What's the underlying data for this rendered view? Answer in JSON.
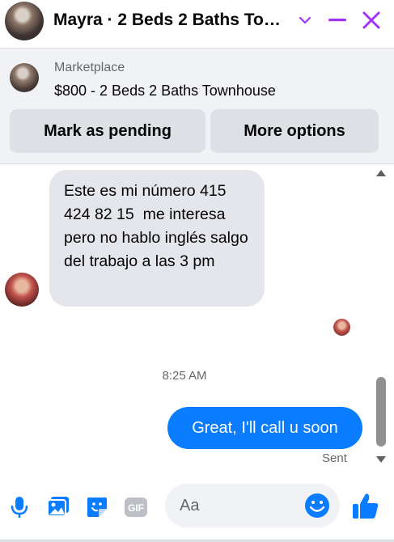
{
  "header": {
    "title": "Mayra · 2 Beds 2 Baths Townhouse",
    "icons": [
      "chevron-down-icon",
      "minimize-icon",
      "close-icon"
    ],
    "accent_color": "#a033ff"
  },
  "marketplace": {
    "label": "Marketplace",
    "listing": "$800 - 2 Beds 2 Baths Townhouse",
    "mark_pending_label": "Mark as pending",
    "more_options_label": "More options"
  },
  "thread": {
    "incoming_message": "Este es mi número 415 424 82 15  me interesa pero no hablo inglés salgo del trabajo a las 3 pm",
    "timestamp": "8:25 AM",
    "outgoing_message": "Great, I'll call u soon",
    "status": "Sent",
    "outgoing_color": "#0a7cff"
  },
  "composer": {
    "placeholder": "Aa",
    "icons": [
      "microphone-icon",
      "photo-icon",
      "sticker-icon",
      "gif-icon",
      "emoji-icon",
      "thumbs-up-icon"
    ],
    "gif_label": "GIF",
    "icon_color": "#0a7cff"
  }
}
